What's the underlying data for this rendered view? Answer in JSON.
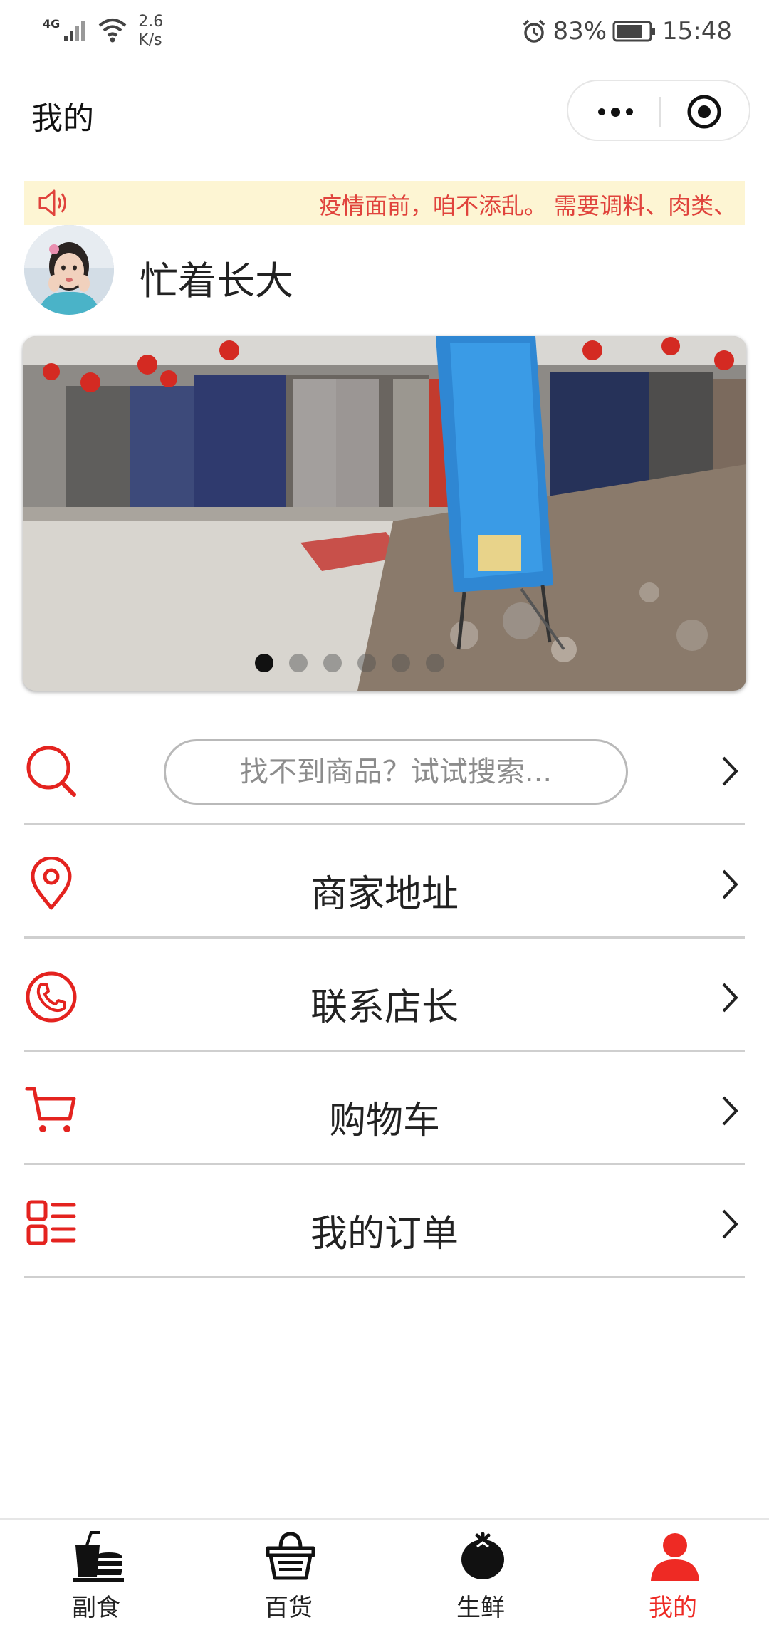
{
  "status_bar": {
    "network": "4G",
    "speed_value": "2.6",
    "speed_unit": "K/s",
    "battery": "83%",
    "time": "15:48"
  },
  "header": {
    "title": "我的"
  },
  "notice": {
    "text": "疫情面前，咱不添乱。 需要调料、肉类、"
  },
  "profile": {
    "nickname": "忙着长大"
  },
  "banner": {
    "slide_count": 6,
    "active_index": 0
  },
  "menu": {
    "search_placeholder": "找不到商品？试试搜索...",
    "items": [
      {
        "label": "商家地址",
        "icon": "location-pin-icon"
      },
      {
        "label": "联系店长",
        "icon": "phone-icon"
      },
      {
        "label": "购物车",
        "icon": "cart-icon"
      },
      {
        "label": "我的订单",
        "icon": "order-list-icon"
      }
    ]
  },
  "tabbar": {
    "tabs": [
      {
        "label": "副食",
        "icon": "snack-drink-icon"
      },
      {
        "label": "百货",
        "icon": "basket-icon"
      },
      {
        "label": "生鲜",
        "icon": "tomato-icon"
      },
      {
        "label": "我的",
        "icon": "user-icon"
      }
    ],
    "active": "我的"
  },
  "colors": {
    "accent_red": "#ee2a24",
    "notice_bg": "#fdf5d3",
    "notice_text": "#e0433c"
  }
}
